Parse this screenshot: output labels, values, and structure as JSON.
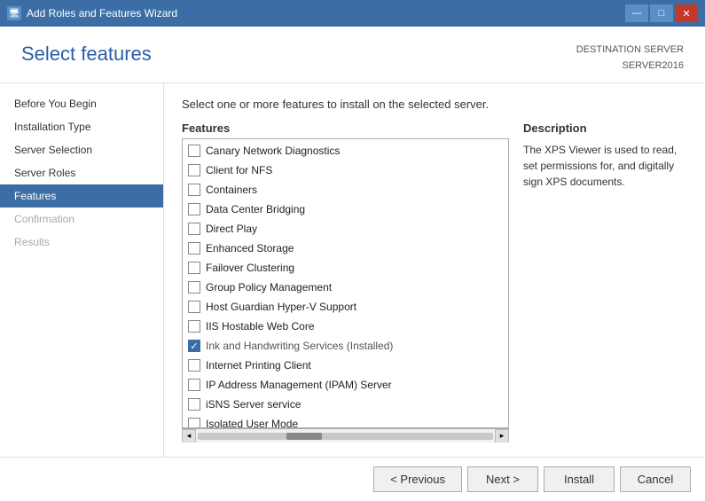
{
  "titleBar": {
    "icon": "🖥",
    "title": "Add Roles and Features Wizard",
    "controls": {
      "minimize": "—",
      "maximize": "□",
      "close": "✕"
    }
  },
  "header": {
    "title": "Select features",
    "destinationLabel": "DESTINATION SERVER",
    "serverName": "SERVER2016"
  },
  "sidebar": {
    "items": [
      {
        "id": "before-you-begin",
        "label": "Before You Begin",
        "state": "normal"
      },
      {
        "id": "installation-type",
        "label": "Installation Type",
        "state": "normal"
      },
      {
        "id": "server-selection",
        "label": "Server Selection",
        "state": "normal"
      },
      {
        "id": "server-roles",
        "label": "Server Roles",
        "state": "normal"
      },
      {
        "id": "features",
        "label": "Features",
        "state": "active"
      },
      {
        "id": "confirmation",
        "label": "Confirmation",
        "state": "disabled"
      },
      {
        "id": "results",
        "label": "Results",
        "state": "disabled"
      }
    ]
  },
  "main": {
    "description": "Select one or more features to install on the selected server.",
    "featuresLabel": "Features",
    "features": [
      {
        "id": "canary-network",
        "label": "Canary Network Diagnostics",
        "checked": false,
        "installed": false
      },
      {
        "id": "client-nfs",
        "label": "Client for NFS",
        "checked": false,
        "installed": false
      },
      {
        "id": "containers",
        "label": "Containers",
        "checked": false,
        "installed": false
      },
      {
        "id": "data-center",
        "label": "Data Center Bridging",
        "checked": false,
        "installed": false
      },
      {
        "id": "direct-play",
        "label": "Direct Play",
        "checked": false,
        "installed": false
      },
      {
        "id": "enhanced-storage",
        "label": "Enhanced Storage",
        "checked": false,
        "installed": false
      },
      {
        "id": "failover-clustering",
        "label": "Failover Clustering",
        "checked": false,
        "installed": false
      },
      {
        "id": "group-policy",
        "label": "Group Policy Management",
        "checked": false,
        "installed": false
      },
      {
        "id": "host-guardian",
        "label": "Host Guardian Hyper-V Support",
        "checked": false,
        "installed": false
      },
      {
        "id": "iis-hostable",
        "label": "IIS Hostable Web Core",
        "checked": false,
        "installed": false
      },
      {
        "id": "ink-handwriting",
        "label": "Ink and Handwriting Services (Installed)",
        "checked": true,
        "installed": true
      },
      {
        "id": "internet-printing",
        "label": "Internet Printing Client",
        "checked": false,
        "installed": false
      },
      {
        "id": "ip-address",
        "label": "IP Address Management (IPAM) Server",
        "checked": false,
        "installed": false
      },
      {
        "id": "isns",
        "label": "iSNS Server service",
        "checked": false,
        "installed": false
      },
      {
        "id": "isolated-user",
        "label": "Isolated User Mode",
        "checked": false,
        "installed": false
      }
    ],
    "descriptionLabel": "Description",
    "descriptionText": "The XPS Viewer is used to read, set permissions for, and digitally sign XPS documents."
  },
  "footer": {
    "previousLabel": "< Previous",
    "nextLabel": "Next >",
    "installLabel": "Install",
    "cancelLabel": "Cancel"
  }
}
